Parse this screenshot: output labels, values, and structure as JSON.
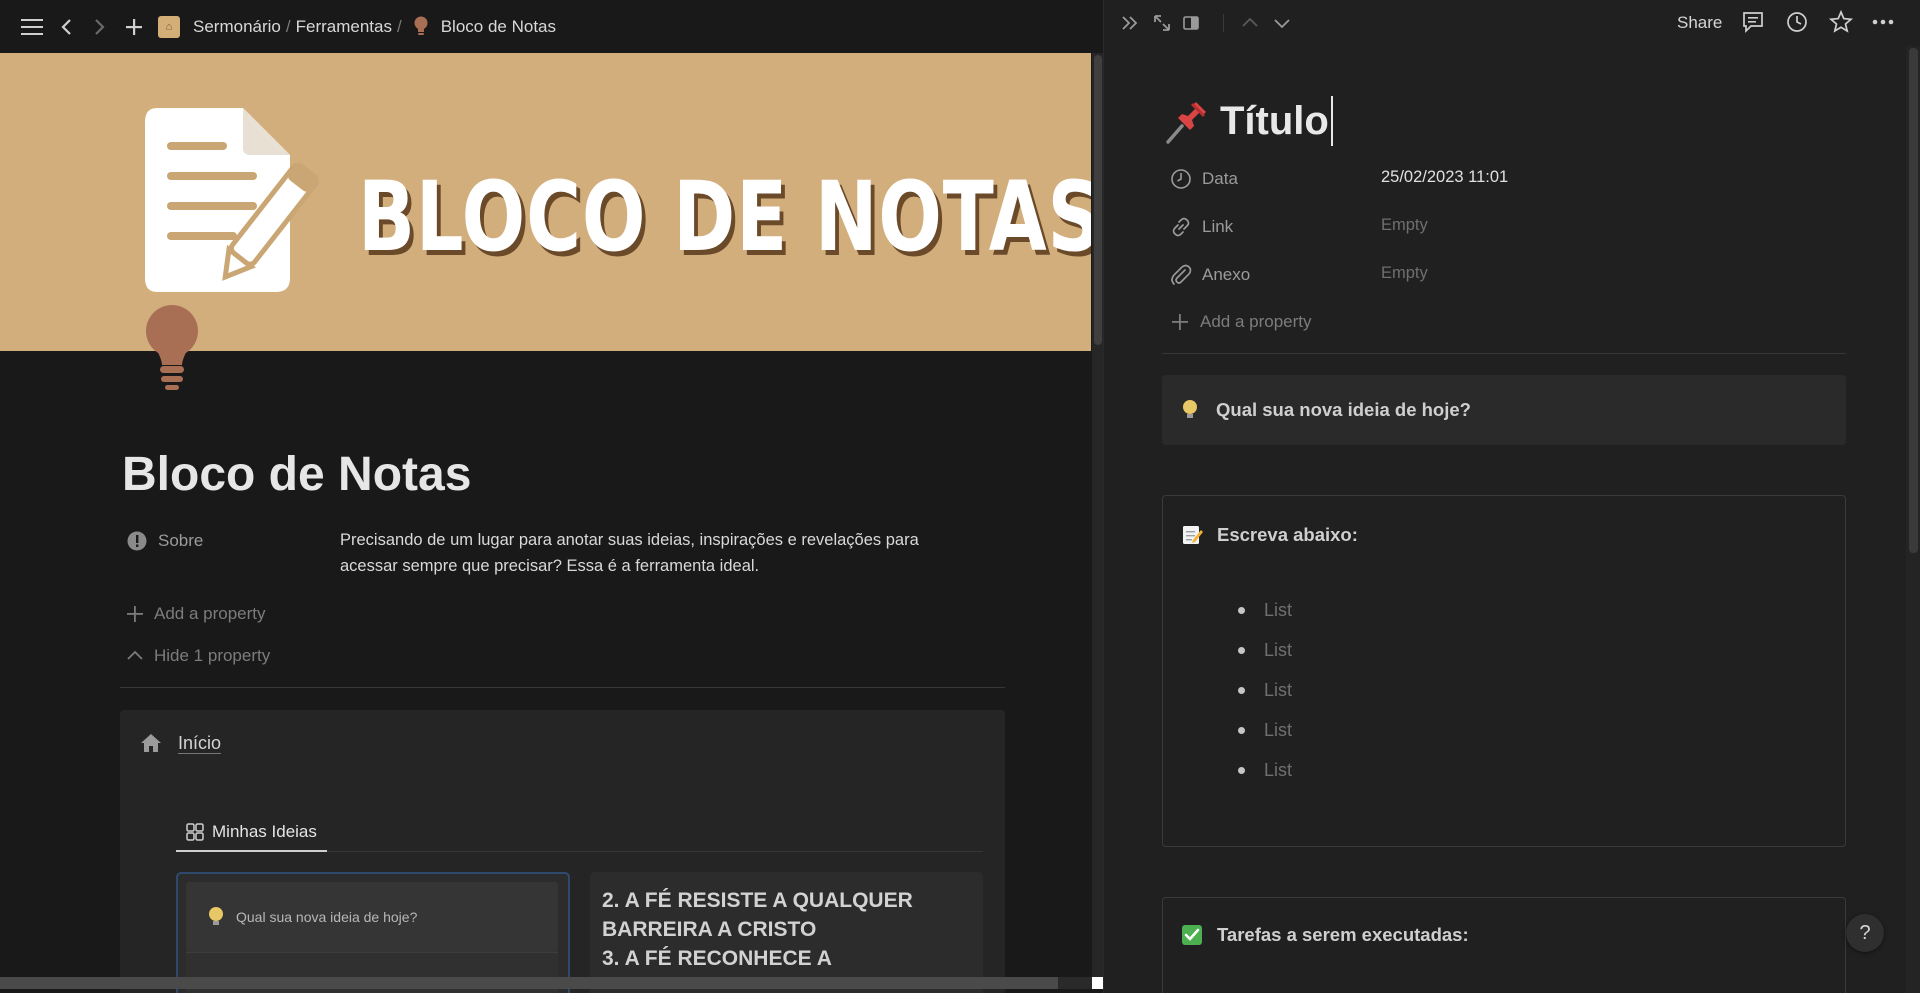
{
  "breadcrumb": {
    "workspace": "Sermonário",
    "sep1": "/",
    "section": "Ferramentas",
    "sep2": "/",
    "page": "Bloco de Notas"
  },
  "cover": {
    "title": "BLOCO DE NOTAS"
  },
  "page": {
    "title": "Bloco de Notas",
    "property_sobre_label": "Sobre",
    "property_sobre_value": "Precisando de um lugar para anotar suas ideias, inspirações e revelações para acessar sempre que precisar? Essa é a ferramenta ideal.",
    "add_property": "Add a property",
    "hide_property": "Hide 1 property"
  },
  "inicio": {
    "label": "Início"
  },
  "view_tabs": [
    {
      "label": "Minhas Ideias"
    }
  ],
  "gallery": {
    "card1": {
      "callout_text": "Qual sua nova ideia de hoje?"
    },
    "card2": {
      "lines": [
        "2. A FÉ RESISTE A QUALQUER",
        "BARREIRA A CRISTO",
        "3. A FÉ RECONHECE A"
      ]
    }
  },
  "peek": {
    "share_label": "Share",
    "title": "Título",
    "properties": [
      {
        "label": "Data",
        "value": "25/02/2023 11:01"
      },
      {
        "label": "Link",
        "value": "Empty"
      },
      {
        "label": "Anexo",
        "value": "Empty"
      }
    ],
    "add_property": "Add a property",
    "callout": {
      "text": "Qual sua nova ideia de hoje?"
    },
    "write_box": {
      "heading": "Escreva abaixo:",
      "items": [
        "List",
        "List",
        "List",
        "List",
        "List"
      ]
    },
    "tasks_box": {
      "heading": "Tarefas a serem executadas:"
    },
    "help_label": "?"
  },
  "colors": {
    "cover_bg": "#d3ae7d",
    "app_bg": "#191919",
    "peek_bg": "#202020",
    "bulb_icon": "#a86f55"
  }
}
